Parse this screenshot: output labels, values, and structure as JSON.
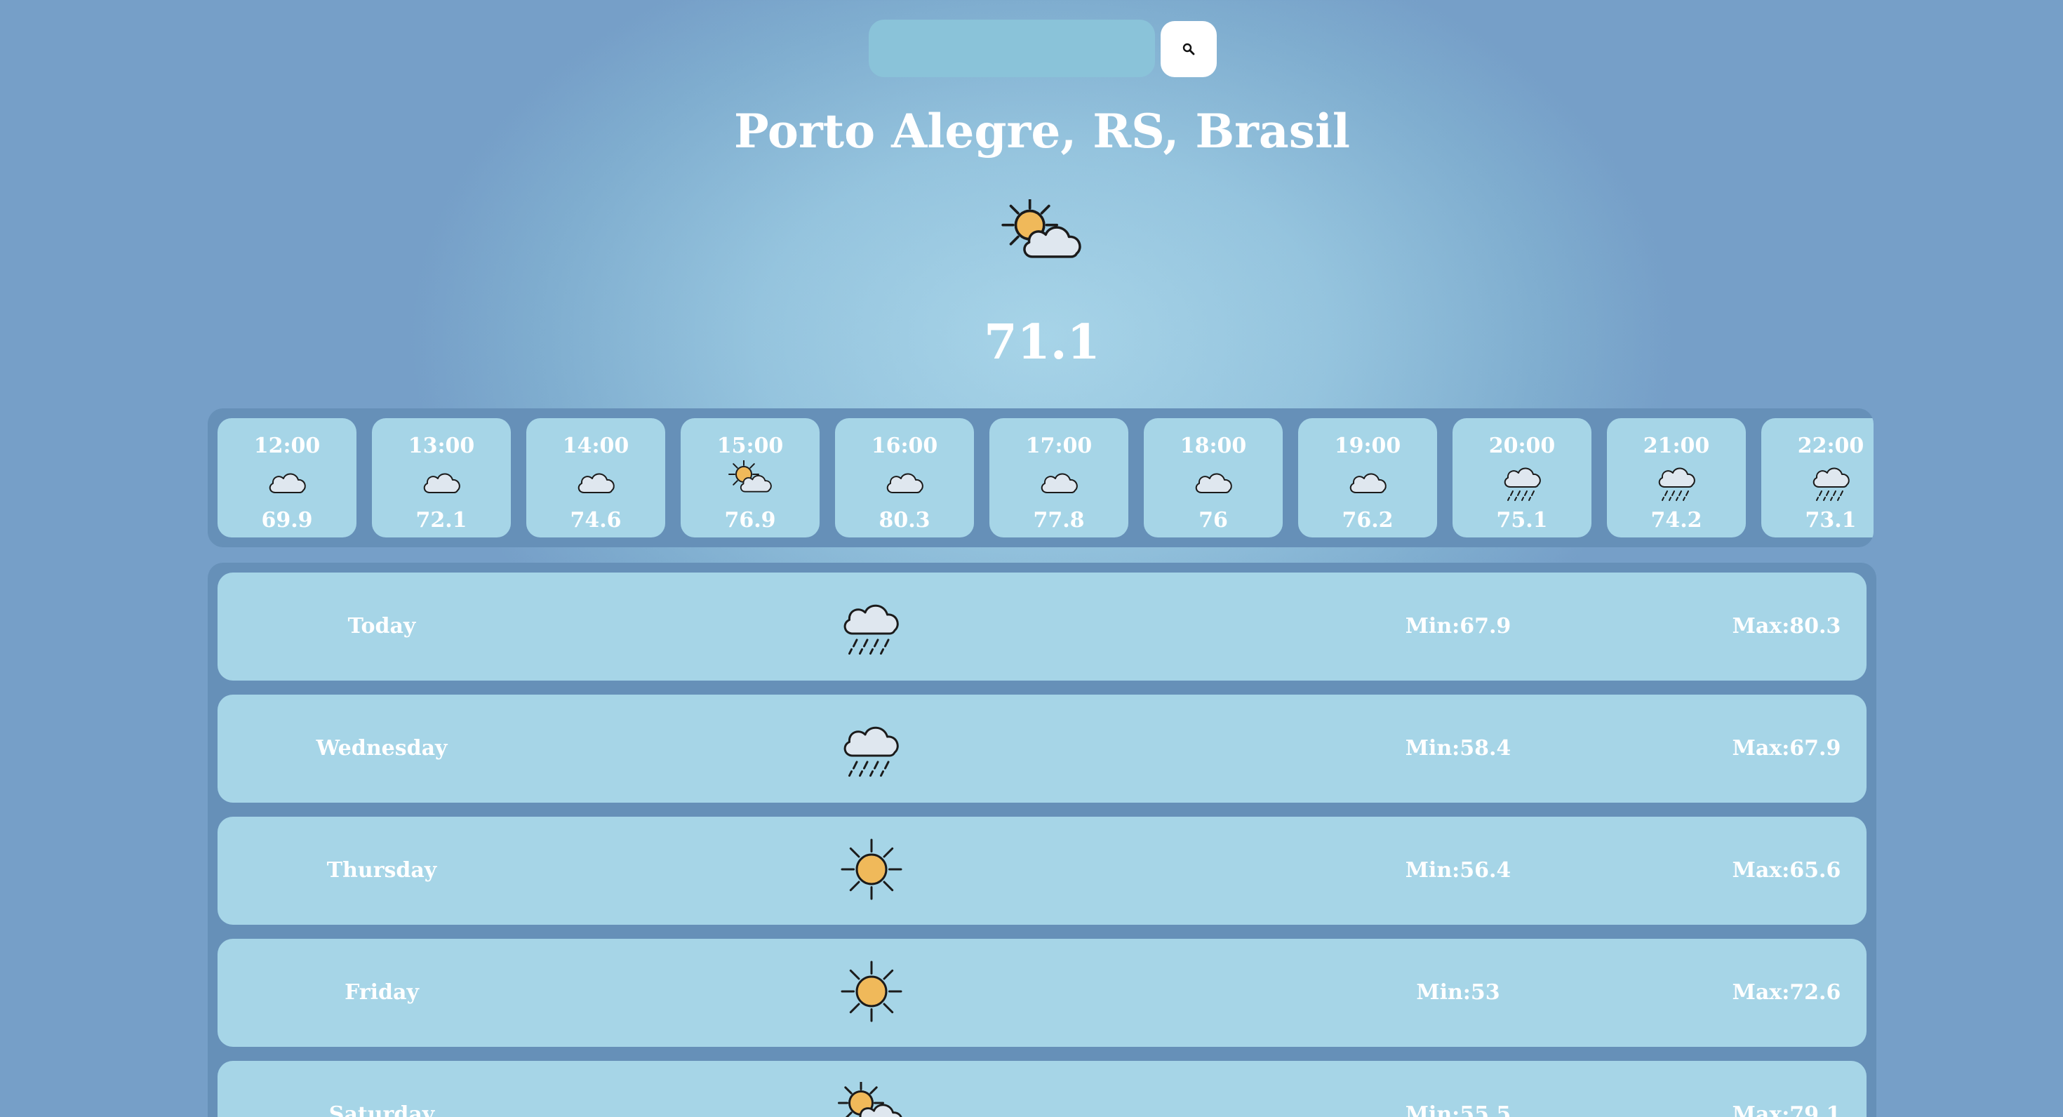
{
  "search": {
    "value": "",
    "placeholder": "",
    "button_icon": "search-icon"
  },
  "location": {
    "name": "Porto Alegre, RS, Brasil"
  },
  "current": {
    "icon": "partly-cloudy-icon",
    "temperature": "71.1"
  },
  "hourly": [
    {
      "time": "12:00",
      "icon": "cloudy-icon",
      "temp": "69.9"
    },
    {
      "time": "13:00",
      "icon": "cloudy-icon",
      "temp": "72.1"
    },
    {
      "time": "14:00",
      "icon": "cloudy-icon",
      "temp": "74.6"
    },
    {
      "time": "15:00",
      "icon": "partly-cloudy-icon",
      "temp": "76.9"
    },
    {
      "time": "16:00",
      "icon": "cloudy-icon",
      "temp": "80.3"
    },
    {
      "time": "17:00",
      "icon": "cloudy-icon",
      "temp": "77.8"
    },
    {
      "time": "18:00",
      "icon": "cloudy-icon",
      "temp": "76"
    },
    {
      "time": "19:00",
      "icon": "cloudy-icon",
      "temp": "76.2"
    },
    {
      "time": "20:00",
      "icon": "rain-icon",
      "temp": "75.1"
    },
    {
      "time": "21:00",
      "icon": "rain-icon",
      "temp": "74.2"
    },
    {
      "time": "22:00",
      "icon": "rain-icon",
      "temp": "73.1"
    }
  ],
  "daily": [
    {
      "day": "Today",
      "icon": "rain-icon",
      "min": "Min:67.9",
      "max": "Max:80.3"
    },
    {
      "day": "Wednesday",
      "icon": "rain-icon",
      "min": "Min:58.4",
      "max": "Max:67.9"
    },
    {
      "day": "Thursday",
      "icon": "sun-icon",
      "min": "Min:56.4",
      "max": "Max:65.6"
    },
    {
      "day": "Friday",
      "icon": "sun-icon",
      "min": "Min:53",
      "max": "Max:72.6"
    },
    {
      "day": "Saturday",
      "icon": "partly-cloudy-icon",
      "min": "Min:55.5",
      "max": "Max:79.1"
    }
  ],
  "colors": {
    "sun": "#f0b95a",
    "cloud": "#dfe7ef",
    "outline": "#1b1b1b",
    "panel": "#6690b8",
    "card": "#a6d5e7"
  }
}
